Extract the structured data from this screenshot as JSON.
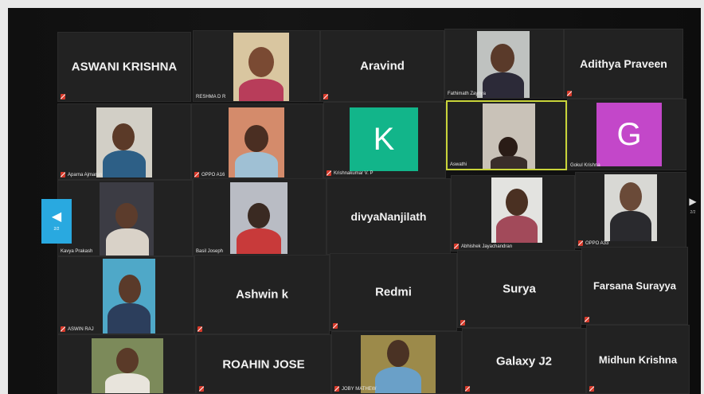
{
  "tiles": {
    "aswani": "ASWANI KRISHNA",
    "reshma": "RESHMA D R",
    "aravind": "Aravind",
    "fathimath": "Fathimath Zaynya",
    "adithya": "Adithya Praveen",
    "aparna": "Aparna Ajmaran",
    "oppo_a16": "OPPO A16",
    "krishnakumar": "Krishnakumar V. P",
    "krishnakumar_initial": "K",
    "aswathi": "Aswathi",
    "gokul": "Gokul Krishna",
    "gokul_initial": "G",
    "kavya": "Kavya Prakash",
    "basil": "Basil Joseph",
    "divya": "divyaNanjilath",
    "abhishek": "Abhishek Jayachandran",
    "oppo_a33": "OPPO A33",
    "aswin_raj": "ASWIN RAJ",
    "ashwin_k": "Ashwin k",
    "redmi": "Redmi",
    "surya": "Surya",
    "farsana": "Farsana Surayya",
    "roahin": "ROAHIN JOSE",
    "joby": "JOBY MATHEW",
    "galaxy": "Galaxy J2",
    "midhun": "Midhun Krishna"
  },
  "pager": {
    "left": "2/2",
    "right": "2/2"
  },
  "colors": {
    "k_tile": "#12b58a",
    "g_tile": "#c347c9",
    "active_border": "#c9d43a",
    "prev_button": "#29a9e0"
  }
}
